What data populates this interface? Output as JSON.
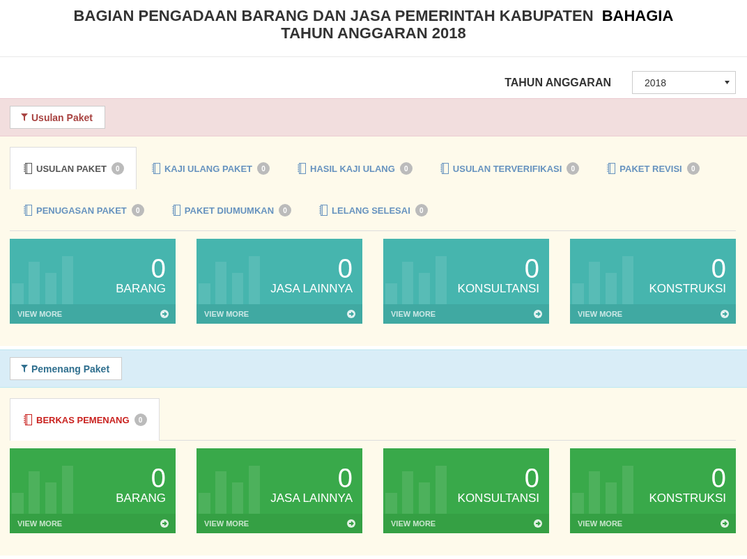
{
  "header": {
    "title": "BAGIAN PENGADAAN BARANG DAN JASA PEMERINTAH KABUPATEN **BAHAGIA**",
    "subtitle": "TAHUN ANGGARAN 2018"
  },
  "year_filter": {
    "label": "TAHUN ANGGARAN",
    "value": "2018"
  },
  "sections": [
    {
      "kind": "proposal",
      "filter_button": "Usulan Paket",
      "tabs": [
        {
          "label": "USULAN PAKET",
          "count": "0",
          "selected": true
        },
        {
          "label": "KAJI ULANG PAKET",
          "count": "0",
          "selected": false
        },
        {
          "label": "HASIL KAJI ULANG",
          "count": "0",
          "selected": false
        },
        {
          "label": "USULAN TERVERIFIKASI",
          "count": "0",
          "selected": false
        },
        {
          "label": "PAKET REVISI",
          "count": "0",
          "selected": false
        },
        {
          "label": "PENUGASAN PAKET",
          "count": "0",
          "selected": false
        },
        {
          "label": "PAKET DIUMUMKAN",
          "count": "0",
          "selected": false
        },
        {
          "label": "LELANG SELESAI",
          "count": "0",
          "selected": false
        }
      ],
      "cards": [
        {
          "value": "0",
          "label": "BARANG",
          "link": "VIEW MORE"
        },
        {
          "value": "0",
          "label": "JASA LAINNYA",
          "link": "VIEW MORE"
        },
        {
          "value": "0",
          "label": "KONSULTANSI",
          "link": "VIEW MORE"
        },
        {
          "value": "0",
          "label": "KONSTRUKSI",
          "link": "VIEW MORE"
        }
      ]
    },
    {
      "kind": "winner",
      "filter_button": "Pemenang Paket",
      "tabs": [
        {
          "label": "BERKAS PEMENANG",
          "count": "0",
          "selected": true
        }
      ],
      "cards": [
        {
          "value": "0",
          "label": "BARANG",
          "link": "VIEW MORE"
        },
        {
          "value": "0",
          "label": "JASA LAINNYA",
          "link": "VIEW MORE"
        },
        {
          "value": "0",
          "label": "KONSULTANSI",
          "link": "VIEW MORE"
        },
        {
          "value": "0",
          "label": "KONSTRUKSI",
          "link": "VIEW MORE"
        }
      ]
    }
  ]
}
